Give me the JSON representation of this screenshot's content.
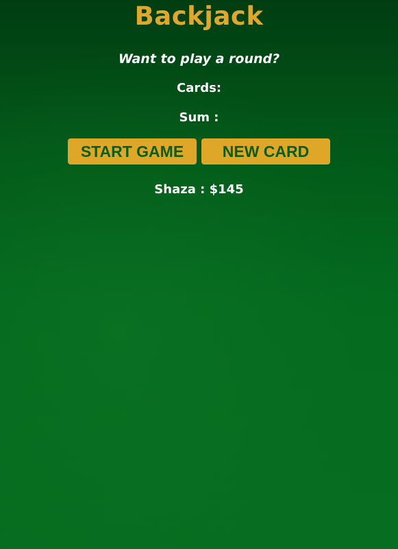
{
  "game": {
    "title": "Backjack",
    "message": "Want to play a round?",
    "cards_label": "Cards:",
    "cards_value": "",
    "sum_label": "Sum :",
    "sum_value": ""
  },
  "buttons": {
    "start_label": "START GAME",
    "new_card_label": "NEW CARD"
  },
  "player": {
    "text": "Shaza : $145"
  },
  "colors": {
    "title": "#e0a82a",
    "button_bg": "#dfa728",
    "button_text": "#0b5d1a",
    "background": "#035a19"
  }
}
